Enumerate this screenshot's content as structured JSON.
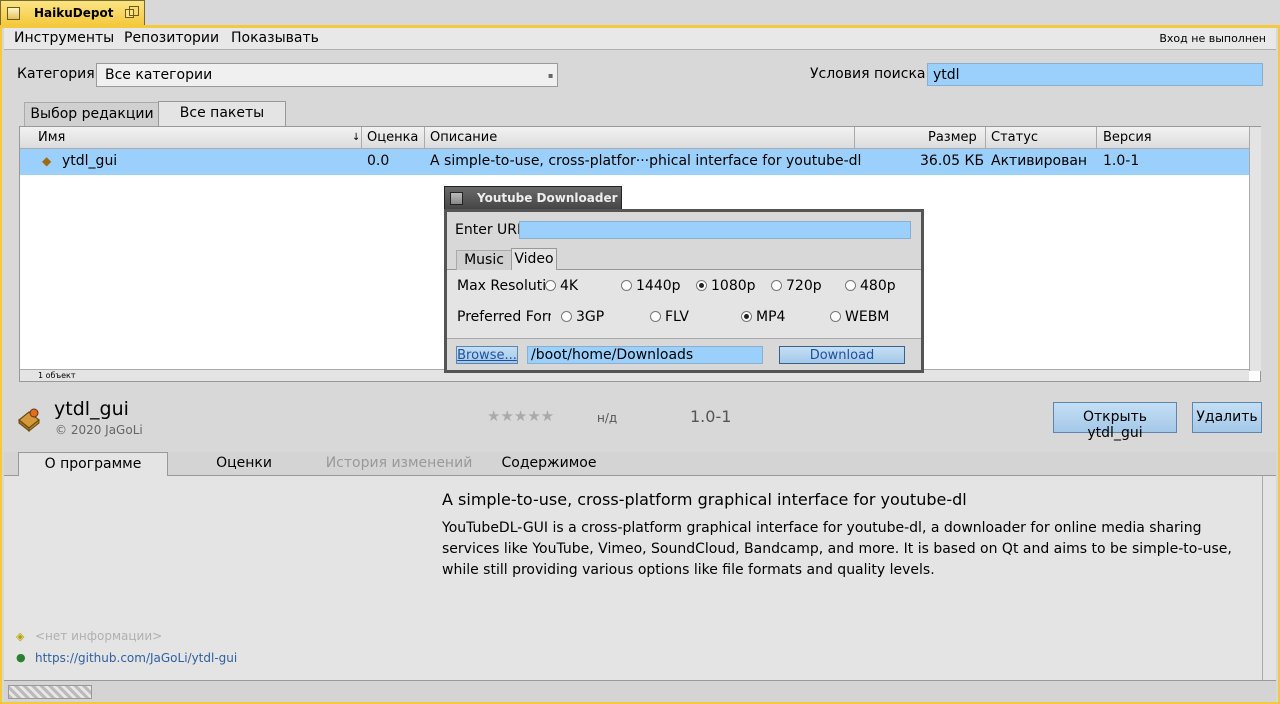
{
  "window": {
    "title": "HaikuDepot"
  },
  "menubar": {
    "items": [
      "Инструменты",
      "Репозитории",
      "Показывать"
    ],
    "status": "Вход не выполнен"
  },
  "filters": {
    "category_label": "Категория:",
    "category_value": "Все категории",
    "search_label": "Условия поиска:",
    "search_value": "ytdl"
  },
  "tabs": [
    "Выбор редакции",
    "Все пакеты"
  ],
  "list": {
    "columns": [
      "Имя",
      "Оценка",
      "Описание",
      "Размер",
      "Статус",
      "Версия"
    ],
    "rows": [
      {
        "name": "ytdl_gui",
        "rating": "0.0",
        "description": "A simple-to-use, cross-platfor···phical interface for youtube-dl",
        "size": "36.05 КБ",
        "status": "Активирован",
        "version": "1.0-1"
      }
    ],
    "count": "1 объект"
  },
  "package": {
    "name": "ytdl_gui",
    "copyright": "© 2020 JaGoLi",
    "stars": "★★★★★",
    "rating_text": "н/д",
    "version": "1.0-1",
    "open_button": "Открыть ytdl_gui",
    "remove_button": "Удалить"
  },
  "detail_tabs": [
    "О программе",
    "Оценки",
    "История изменений",
    "Содержимое"
  ],
  "about": {
    "title": "A simple-to-use, cross-platform graphical interface for youtube-dl",
    "body": "YouTubeDL-GUI is a cross-platform graphical interface for youtube-dl, a downloader for online media sharing services like YouTube, Vimeo, SoundCloud, Bandcamp, and more. It is based on Qt and aims to be simple-to-use, while still providing various options like file formats and quality levels.",
    "no_info": "<нет информации>",
    "url": "https://github.com/JaGoLi/ytdl-gui"
  },
  "dialog": {
    "title": "Youtube Downloader",
    "url_label": "Enter URL",
    "tabs": [
      "Music",
      "Video"
    ],
    "res_label": "Max Resolution",
    "resolutions": [
      "4K",
      "1440p",
      "1080p",
      "720p",
      "480p"
    ],
    "fmt_label": "Preferred Format",
    "formats": [
      "3GP",
      "FLV",
      "MP4",
      "WEBM"
    ],
    "browse_button": "Browse...",
    "path": "/boot/home/Downloads",
    "download_button": "Download"
  },
  "colors": {
    "title_tab": "#f4c93e",
    "selection": "#9bd0fc",
    "button": "#a4c8e8"
  }
}
